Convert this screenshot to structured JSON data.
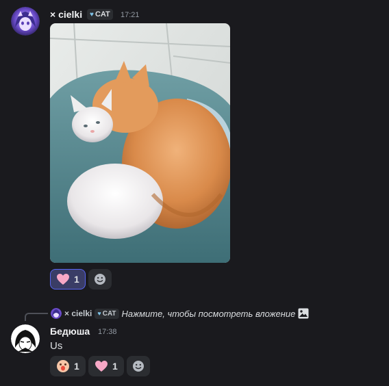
{
  "message1": {
    "username": "× cielki",
    "tag": "CAT",
    "time": "17:21",
    "reactions": [
      {
        "emoji": "heart-emoji",
        "count": "1",
        "active": true
      }
    ]
  },
  "message2": {
    "reply": {
      "username": "× cielki",
      "tag": "CAT",
      "text": "Нажмите, чтобы посмотреть вложение"
    },
    "username": "Бедюша",
    "time": "17:38",
    "text": "Us",
    "reactions": [
      {
        "emoji": "surprised-emoji",
        "count": "1"
      },
      {
        "emoji": "heart-emoji",
        "count": "1"
      }
    ]
  },
  "colors": {
    "background": "#1a1a1e",
    "reaction_active": "#3a3d66",
    "reaction_active_border": "#5865f2",
    "tag_heart": "#7fc3e8"
  }
}
